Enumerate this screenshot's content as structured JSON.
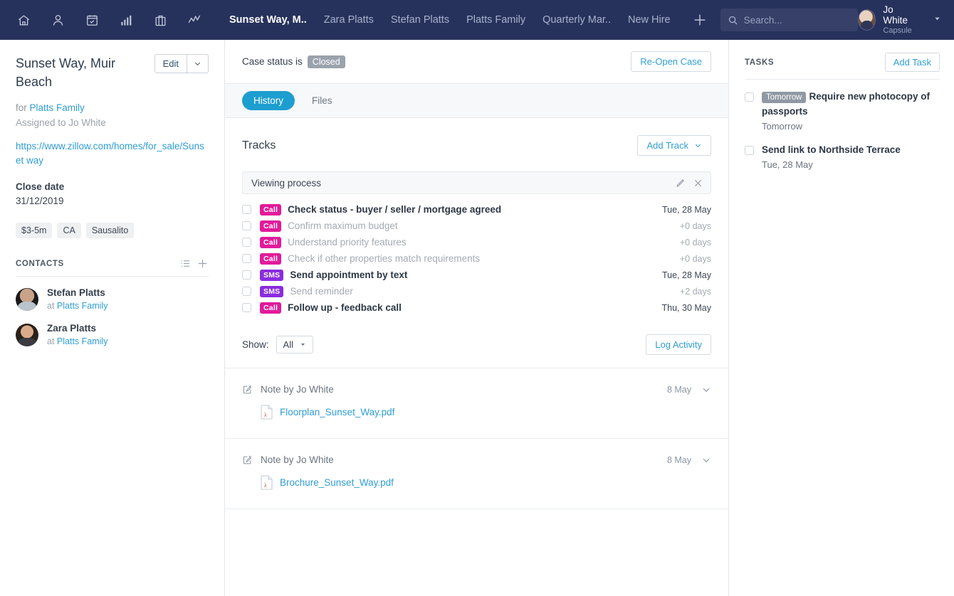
{
  "topnav": {
    "icons": [
      "home-icon",
      "person-icon",
      "calendar-icon",
      "bar-chart-icon",
      "briefcase-icon",
      "activity-icon"
    ],
    "tabs": [
      {
        "label": "Sunset Way, M..",
        "active": true
      },
      {
        "label": "Zara Platts",
        "active": false
      },
      {
        "label": "Stefan Platts",
        "active": false
      },
      {
        "label": "Platts Family",
        "active": false
      },
      {
        "label": "Quarterly Mar..",
        "active": false
      },
      {
        "label": "New Hire",
        "active": false
      }
    ],
    "add_label": "+",
    "search": {
      "placeholder": "Search...",
      "value": ""
    },
    "user": {
      "name": "Jo White",
      "org": "Capsule"
    }
  },
  "left": {
    "title": "Sunset Way, Muir Beach",
    "edit_label": "Edit",
    "for_prefix": "for",
    "for_link": "Platts Family",
    "assigned": "Assigned to Jo White",
    "url": "https://www.zillow.com/homes/for_sale/Sunset way",
    "close_date_label": "Close date",
    "close_date_value": "31/12/2019",
    "tags": [
      "$3-5m",
      "CA",
      "Sausalito"
    ],
    "contacts_title": "CONTACTS",
    "contacts": [
      {
        "name": "Stefan Platts",
        "at_prefix": "at",
        "org": "Platts Family"
      },
      {
        "name": "Zara Platts",
        "at_prefix": "at",
        "org": "Platts Family"
      }
    ]
  },
  "center": {
    "case_status_prefix": "Case status is",
    "case_status_value": "Closed",
    "reopen_label": "Re-Open Case",
    "tabs": [
      {
        "label": "History",
        "active": true
      },
      {
        "label": "Files",
        "active": false
      }
    ],
    "tracks": {
      "title": "Tracks",
      "add_track_label": "Add Track",
      "track_name": "Viewing process",
      "items": [
        {
          "type": "Call",
          "label": "Check status - buyer / seller / mortgage agreed",
          "date": "Tue, 28 May",
          "state": "done"
        },
        {
          "type": "Call",
          "label": "Confirm maximum budget",
          "date": "+0 days",
          "state": "pending"
        },
        {
          "type": "Call",
          "label": "Understand priority features",
          "date": "+0 days",
          "state": "pending"
        },
        {
          "type": "Call",
          "label": "Check if other properties match requirements",
          "date": "+0 days",
          "state": "pending"
        },
        {
          "type": "SMS",
          "label": "Send appointment by text",
          "date": "Tue, 28 May",
          "state": "done"
        },
        {
          "type": "SMS",
          "label": "Send reminder",
          "date": "+2 days",
          "state": "pending"
        },
        {
          "type": "Call",
          "label": "Follow up - feedback call",
          "date": "Thu, 30 May",
          "state": "done"
        }
      ],
      "show_label": "Show:",
      "show_value": "All",
      "log_activity_label": "Log Activity"
    },
    "notes": [
      {
        "title": "Note by Jo White",
        "date": "8 May",
        "file": "Floorplan_Sunset_Way.pdf"
      },
      {
        "title": "Note by Jo White",
        "date": "8 May",
        "file": "Brochure_Sunset_Way.pdf"
      }
    ]
  },
  "right": {
    "title": "TASKS",
    "add_task_label": "Add Task",
    "tasks": [
      {
        "badge": "Tomorrow",
        "title": "Require new photocopy of passports",
        "sub": "Tomorrow"
      },
      {
        "badge": "",
        "title": "Send link to Northside Terrace",
        "sub": "Tue, 28 May"
      }
    ]
  },
  "colors": {
    "navbar": "#27325c",
    "accent": "#2f9ed4",
    "tab_active": "#1d9ed0",
    "call_badge": "#e21a9b",
    "sms_badge": "#8a2ce0",
    "status_badge": "#9aa2ac"
  }
}
